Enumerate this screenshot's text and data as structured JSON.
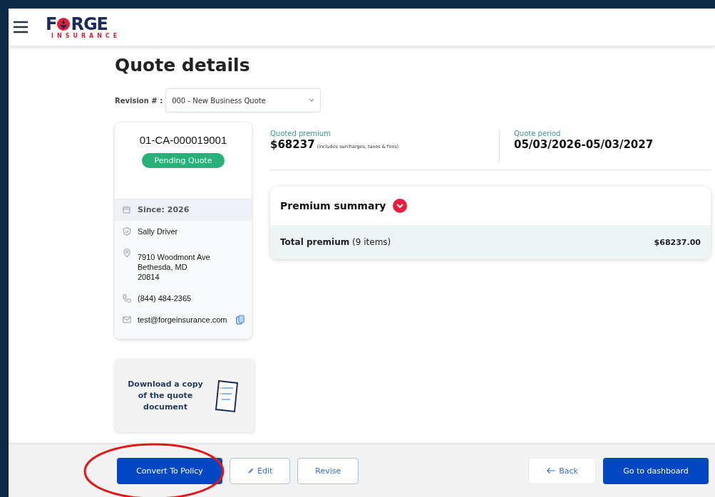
{
  "header": {
    "logo": {
      "before": "F",
      "after": "RGE",
      "tagline": "INSURANCE"
    }
  },
  "title": "Quote details",
  "revision": {
    "label": "Revision # :",
    "value": "000 - New Business Quote"
  },
  "quote_card": {
    "number": "01-CA-000019001",
    "status": "Pending Quote",
    "details": [
      {
        "kind": "since",
        "text": "Since: 2026"
      },
      {
        "kind": "person",
        "text": "Sally Driver"
      },
      {
        "kind": "location",
        "lines": [
          "7910 Woodmont Ave",
          "Bethesda, MD",
          "20814"
        ]
      },
      {
        "kind": "phone",
        "text": "(844) 484-2365"
      },
      {
        "kind": "email",
        "text": "test@forgeinsurance.com"
      }
    ]
  },
  "download_card": {
    "text": "Download a copy of the quote document"
  },
  "summary": {
    "quoted_premium": {
      "label": "Quoted premium",
      "value": "$68237",
      "note": "(includes surcharges, taxes & fees)"
    },
    "quote_period": {
      "label": "Quote period",
      "value": "05/03/2026-05/03/2027"
    }
  },
  "premium_summary": {
    "title": "Premium summary",
    "expanded": true,
    "total_label": "Total premium",
    "total_count": "(9 items)",
    "total_value": "$68237.00"
  },
  "footer": {
    "left_buttons": [
      {
        "label": "Convert To Policy",
        "kind": "primary",
        "circled": true
      },
      {
        "label": "Edit",
        "kind": "edit",
        "circled": false
      },
      {
        "label": "Revise",
        "kind": "outline",
        "circled": false
      }
    ],
    "right_buttons": [
      {
        "label": "Back",
        "kind": "back",
        "circled": false
      },
      {
        "label": "Go to dashboard",
        "kind": "primary",
        "circled": false
      }
    ]
  }
}
